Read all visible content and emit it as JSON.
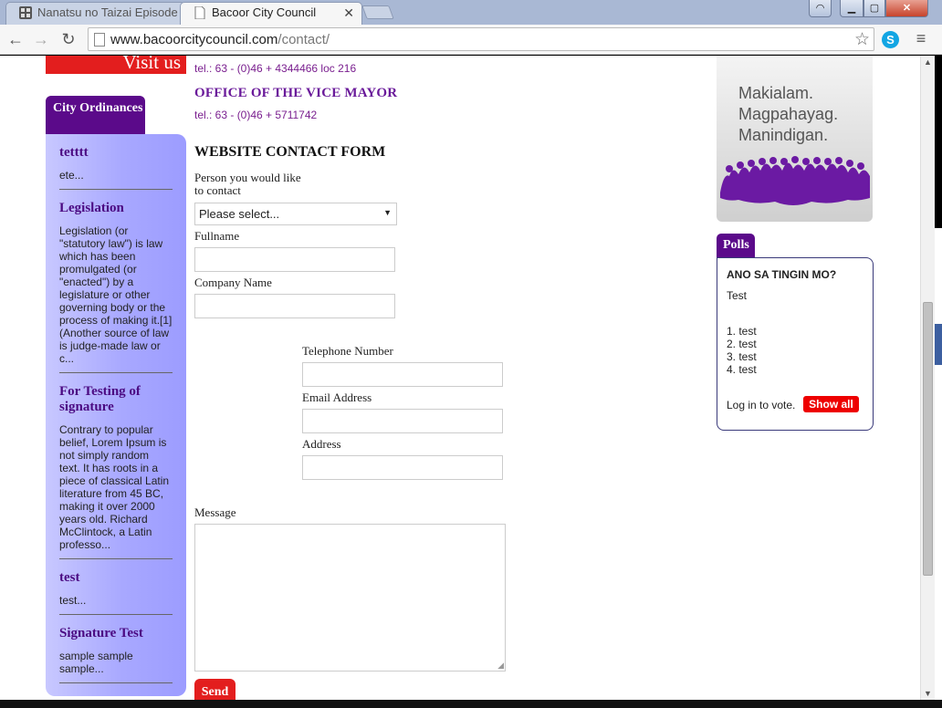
{
  "browser": {
    "tabs": [
      {
        "label": "Nanatsu no Taizai Episode",
        "active": false
      },
      {
        "label": "Bacoor City Council",
        "active": true
      }
    ],
    "tab_close_glyph": "✕",
    "url_domain": "www.bacoorcitycouncil.com",
    "url_path": "/contact/"
  },
  "banner": {
    "visit_label": "Visit us"
  },
  "sidebar": {
    "tab_title": "City Ordinances",
    "items": [
      {
        "title": "tetttt",
        "text": "ete..."
      },
      {
        "title": "Legislation",
        "text": "Legislation (or \"statutory law\") is law which has been promulgated (or \"enacted\") by a legislature or other governing body or the process of making it.[1] (Another source of law is judge-made law or c..."
      },
      {
        "title": "For Testing of signature",
        "text": "Contrary to popular belief, Lorem Ipsum is not simply random text. It has roots in a piece of classical Latin literature from 45 BC, making it over 2000 years old. Richard McClintock, a Latin professo..."
      },
      {
        "title": "test",
        "text": "test..."
      },
      {
        "title": "Signature Test",
        "text": "sample sample sample..."
      }
    ]
  },
  "contact": {
    "tel1": "tel.: 63 - (0)46 + 4344466 loc 216",
    "vice_mayor_heading": "OFFICE OF THE VICE MAYOR",
    "tel2": "tel.: 63 - (0)46 + 5711742"
  },
  "form": {
    "heading": "WEBSITE CONTACT FORM",
    "contact_label_line1": "Person you would like",
    "contact_label_line2": "to contact",
    "contact_select_value": "Please select...",
    "fullname_label": "Fullname",
    "company_label": "Company Name",
    "telephone_label": "Telephone Number",
    "email_label": "Email Address",
    "address_label": "Address",
    "message_label": "Message",
    "send_label": "Send"
  },
  "slogan": {
    "line1": "Makialam.",
    "line2": "Magpahayag.",
    "line3": "Manindigan."
  },
  "polls": {
    "tab_title": "Polls",
    "question": "ANO SA TINGIN MO?",
    "subtitle": "Test",
    "options": [
      "1. test",
      "2. test",
      "3. test",
      "4. test"
    ],
    "login_text": "Log in to vote.",
    "show_all_label": "Show all"
  },
  "colors": {
    "accent_purple": "#5b0a8a",
    "accent_red": "#e31e1e",
    "sidebar_gradient_end": "#9c9cff"
  }
}
